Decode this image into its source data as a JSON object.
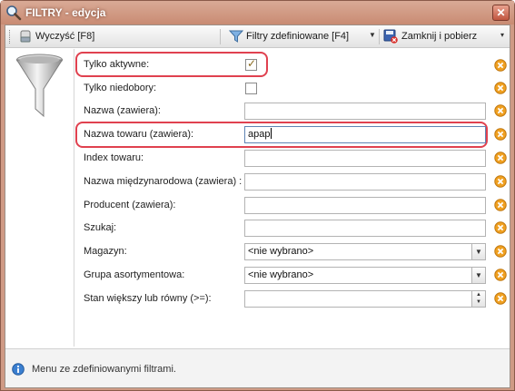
{
  "window": {
    "title": "FILTRY - edycja"
  },
  "toolbar": {
    "clear_label": "Wyczyść [F8]",
    "defined_filters_label": "Filtry zdefiniowane [F4]",
    "close_fetch_label": "Zamknij i pobierz"
  },
  "form": {
    "only_active": {
      "label": "Tylko aktywne:",
      "checked": true
    },
    "only_shortages": {
      "label": "Tylko niedobory:",
      "checked": false
    },
    "name_contains": {
      "label": "Nazwa (zawiera):",
      "value": ""
    },
    "product_name_contains": {
      "label": "Nazwa towaru (zawiera):",
      "value": "apap"
    },
    "product_index": {
      "label": "Index towaru:",
      "value": ""
    },
    "international_name": {
      "label": "Nazwa międzynarodowa (zawiera) :",
      "value": ""
    },
    "manufacturer": {
      "label": "Producent (zawiera):",
      "value": ""
    },
    "search": {
      "label": "Szukaj:",
      "value": ""
    },
    "warehouse": {
      "label": "Magazyn:",
      "value": "<nie wybrano>"
    },
    "product_group": {
      "label": "Grupa asortymentowa:",
      "value": "<nie wybrano>"
    },
    "stock_gte": {
      "label": "Stan większy lub równy (>=):",
      "value": ""
    }
  },
  "status": {
    "text": "Menu ze zdefiniowanymi filtrami."
  },
  "icons": {
    "title": "magnifier-icon",
    "clear": "eraser-icon",
    "filters": "funnel-icon",
    "close_fetch": "save-close-icon",
    "clear_field": "clear-circle-icon",
    "info": "info-icon"
  },
  "colors": {
    "titlebar": "#cf9a85",
    "highlight": "#e0414f",
    "clear_field_icon": "#f0a020"
  }
}
